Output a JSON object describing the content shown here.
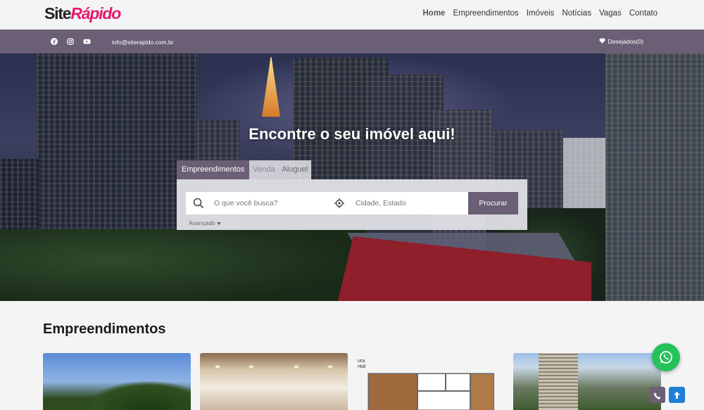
{
  "brand": {
    "part1": "Site",
    "part2": "Rápido"
  },
  "nav": {
    "items": [
      "Home",
      "Empreendimentos",
      "Imóveis",
      "Notícias",
      "Vagas",
      "Contato"
    ]
  },
  "topbar": {
    "social_icons": [
      "facebook-icon",
      "instagram-icon",
      "youtube-icon"
    ],
    "email": "info@siterapido.com.br",
    "wishlist_label": "Desejados(0)"
  },
  "hero": {
    "title": "Encontre o seu imóvel aqui!",
    "tabs": [
      "Empreendimentos",
      "Venda",
      "Aluguel"
    ],
    "active_tab": "Empreendimentos",
    "search_placeholder": "O que você busca?",
    "location_placeholder": "Cidade, Estado",
    "search_button": "Procurar",
    "advanced_label": "Avançado"
  },
  "section": {
    "title": "Empreendimentos"
  },
  "card_plan_label": [
    "ura",
    "ntal"
  ],
  "colors": {
    "accent": "#6a5f75",
    "brand": "#e6196b",
    "whatsapp": "#25c25a",
    "scroll_top": "#1e7fd6"
  }
}
